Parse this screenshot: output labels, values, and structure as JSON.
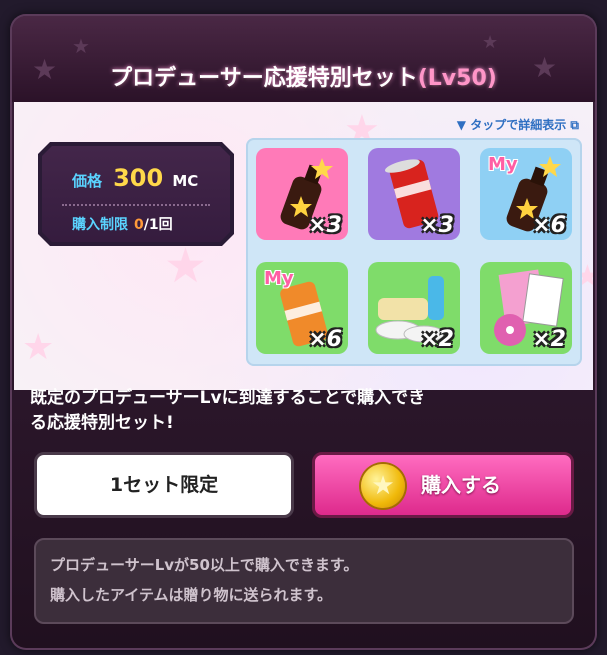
{
  "header": {
    "title": "プロデューサー応援特別セット",
    "level": "(Lv50)"
  },
  "tap_link": "タップで詳細表示",
  "price": {
    "label": "価格",
    "value": "300",
    "unit": "MC"
  },
  "limit": {
    "label": "購入制限",
    "current": "0",
    "total": "/1回"
  },
  "items": [
    {
      "icon": "star-drink-bottle-icon",
      "bg": "#ff7ab8",
      "badge": "",
      "qty": "×3"
    },
    {
      "icon": "energy-can-icon",
      "bg": "#a07ae0",
      "badge": "",
      "qty": "×3"
    },
    {
      "icon": "my-star-drink-bottle-icon",
      "bg": "#8fd0f4",
      "badge": "My",
      "qty": "×6"
    },
    {
      "icon": "my-energy-can-icon",
      "bg": "#7fdc6a",
      "badge": "My",
      "qty": "×6"
    },
    {
      "icon": "towel-shoes-drink-icon",
      "bg": "#7fdc6a",
      "badge": "",
      "qty": "×2"
    },
    {
      "icon": "lesson-dvd-icon",
      "bg": "#7fdc6a",
      "badge": "",
      "qty": "×2"
    }
  ],
  "description": {
    "line1": "既定のプロデューサーLvに到達することで購入でき",
    "line2": "る応援特別セット!"
  },
  "buttons": {
    "limit_label": "1セット限定",
    "buy_label": "購入する"
  },
  "notice": {
    "line1": "プロデューサーLvが50以上で購入できます。",
    "line2": "購入したアイテムは贈り物に送られます。"
  },
  "colors": {
    "buy_button": "#ff6cc0",
    "price_value": "#ffd84a",
    "label_cyan": "#5ad3ff",
    "limit_current": "#ff9a3a"
  }
}
